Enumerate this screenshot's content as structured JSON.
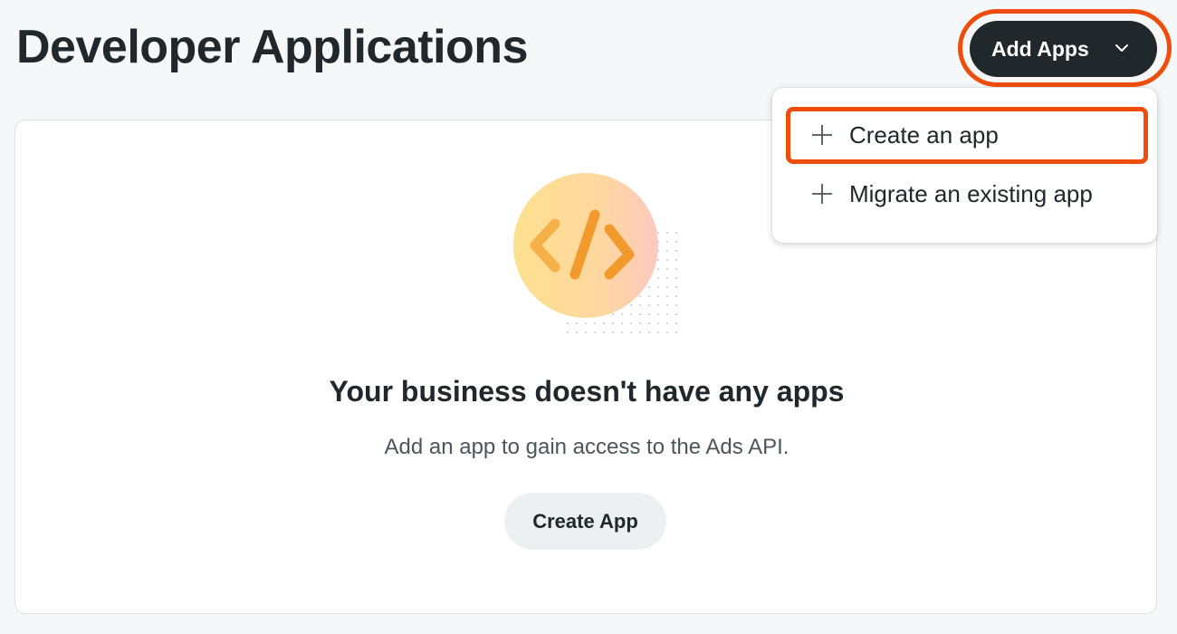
{
  "header": {
    "title": "Developer Applications",
    "add_apps_label": "Add Apps",
    "add_apps_icon": "chevron-down-icon"
  },
  "dropdown": {
    "items": [
      {
        "label": "Create an app",
        "icon": "plus-icon",
        "highlighted": true
      },
      {
        "label": "Migrate an existing app",
        "icon": "plus-icon",
        "highlighted": false
      }
    ]
  },
  "empty_state": {
    "illustration": "code-brackets-icon",
    "title": "Your business doesn't have any apps",
    "subtitle": "Add an app to gain access to the Ads API.",
    "button_label": "Create App"
  },
  "colors": {
    "highlight": "#ef4d0c",
    "primary_button": "#21282b",
    "secondary_button": "#edf0f1",
    "background": "#f6f7f8"
  }
}
